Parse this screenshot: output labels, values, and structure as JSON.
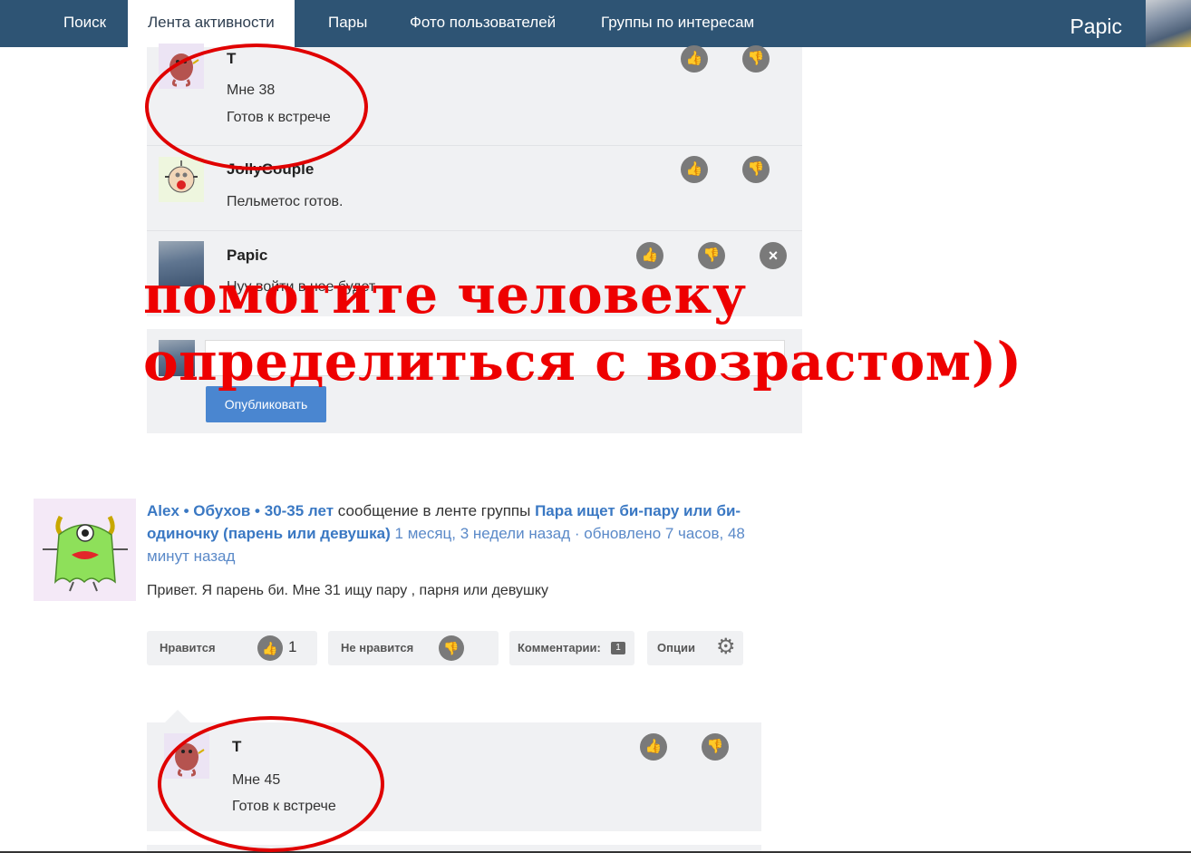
{
  "nav": {
    "tabs": [
      "Поиск",
      "Лента активности",
      "Пары",
      "Фото пользователей",
      "Группы по интересам"
    ],
    "user": "Papic"
  },
  "comments_top": [
    {
      "name": "T",
      "lines": [
        "Мне 38",
        "Готов к встрече"
      ]
    },
    {
      "name": "JollyCouple",
      "lines": [
        "Пельметос готов."
      ]
    },
    {
      "name": "Papic",
      "lines": [
        "Нуу войти в нее будет"
      ]
    }
  ],
  "icons": {
    "like": "thumbs-up-icon",
    "dislike": "thumbs-down-icon",
    "delete": "close-icon",
    "options": "gear-icon"
  },
  "compose": {
    "publish": "Опубликовать"
  },
  "overlay": {
    "line1": "помогите человеку",
    "line2": "определиться с возрастом))"
  },
  "post": {
    "author": "Alex • Обухов • 30-35 лет",
    "action": " сообщение в ленте группы ",
    "group": "Пара ищет би-пару или би-одиночку (парень или девушка)",
    "time": " 1 месяц, 3 недели назад · обновлено 7 часов, 48 минут назад",
    "body": "Привет. Я парень би. Мне 31 ищу пару , парня или девушку",
    "like_label": "Нравится",
    "like_count": "1",
    "dislike_label": "Не нравится",
    "comments_label": "Комментарии:",
    "comments_count": "1",
    "options_label": "Опции"
  },
  "comments_bottom": [
    {
      "name": "T",
      "lines": [
        "Мне 45",
        "Готов к встрече"
      ]
    }
  ],
  "colors": {
    "nav_bg": "#2e5474",
    "accent_blue": "#4a86d0",
    "annotation_red": "#ee0000"
  }
}
